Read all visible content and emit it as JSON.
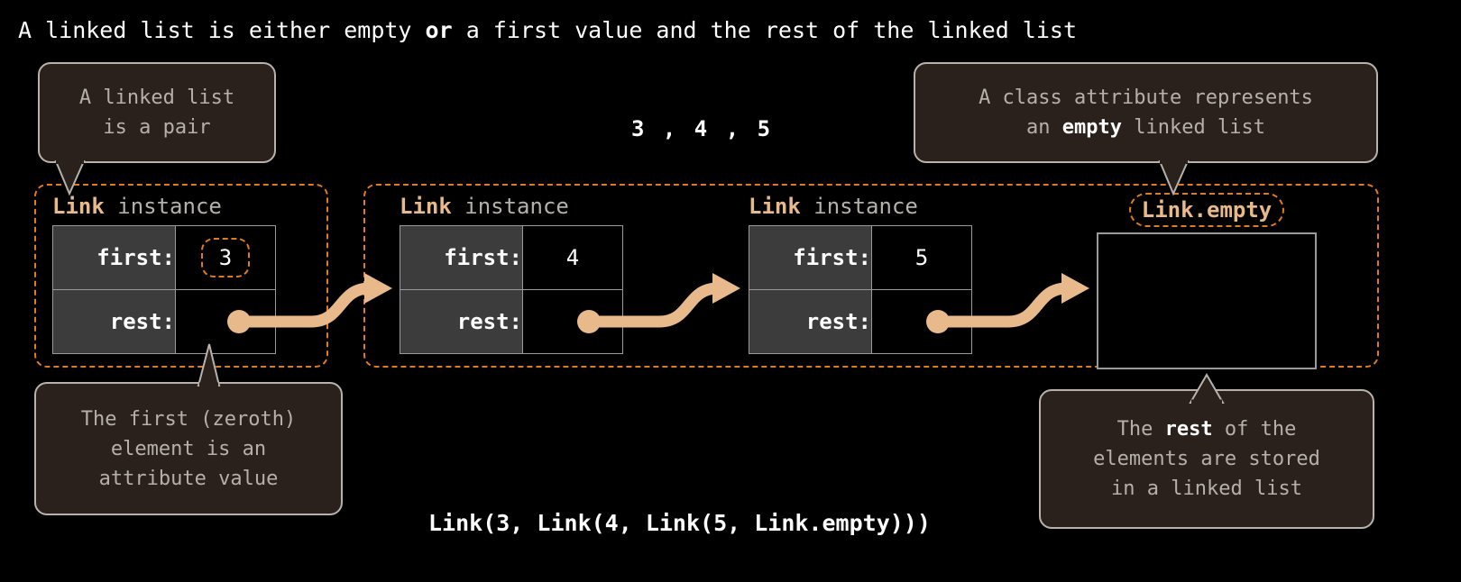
{
  "title": {
    "before": "A linked list is either empty ",
    "bold": "or",
    "after": " a first value and the rest of the linked list"
  },
  "sequence_label": "3 , 4 , 5",
  "expression_label": "Link(3, Link(4, Link(5, Link.empty)))",
  "colors": {
    "background": "#000000",
    "accent_orange": "#e07b20",
    "arrow_tan": "#e8b98a",
    "callout_fill": "#2a211c",
    "callout_border": "#b8b2ac",
    "callout_text": "#b5b0ab",
    "cell_label_bg": "#3c3c3c",
    "cell_border": "#9a9a9a",
    "text_white": "#ffffff"
  },
  "callouts": [
    {
      "name": "a-linked-list-is-a-pair",
      "line1": "A linked list",
      "line2": "is a pair",
      "text": "A linked list\nis a pair"
    },
    {
      "name": "class-attribute-empty",
      "prefix": "A class attribute represents\nan ",
      "bold": "empty",
      "suffix": " linked list"
    },
    {
      "name": "first-zeroth-element",
      "text": "The first (zeroth)\nelement is an\nattribute value"
    },
    {
      "name": "rest-stored-in-linked-list",
      "prefix": "The ",
      "bold": "rest",
      "suffix": " of the\nelements are stored\nin a linked list"
    }
  ],
  "links": [
    {
      "header_class": "Link",
      "header_kind": " instance",
      "rows": [
        {
          "label": "first:",
          "value": "3",
          "highlighted": true
        },
        {
          "label": "rest:",
          "value": "",
          "highlighted": false
        }
      ]
    },
    {
      "header_class": "Link",
      "header_kind": " instance",
      "rows": [
        {
          "label": "first:",
          "value": "4",
          "highlighted": false
        },
        {
          "label": "rest:",
          "value": "",
          "highlighted": false
        }
      ]
    },
    {
      "header_class": "Link",
      "header_kind": " instance",
      "rows": [
        {
          "label": "first:",
          "value": "5",
          "highlighted": false
        },
        {
          "label": "rest:",
          "value": "",
          "highlighted": false
        }
      ]
    }
  ],
  "empty_link": {
    "header": "Link.empty",
    "body": ""
  }
}
